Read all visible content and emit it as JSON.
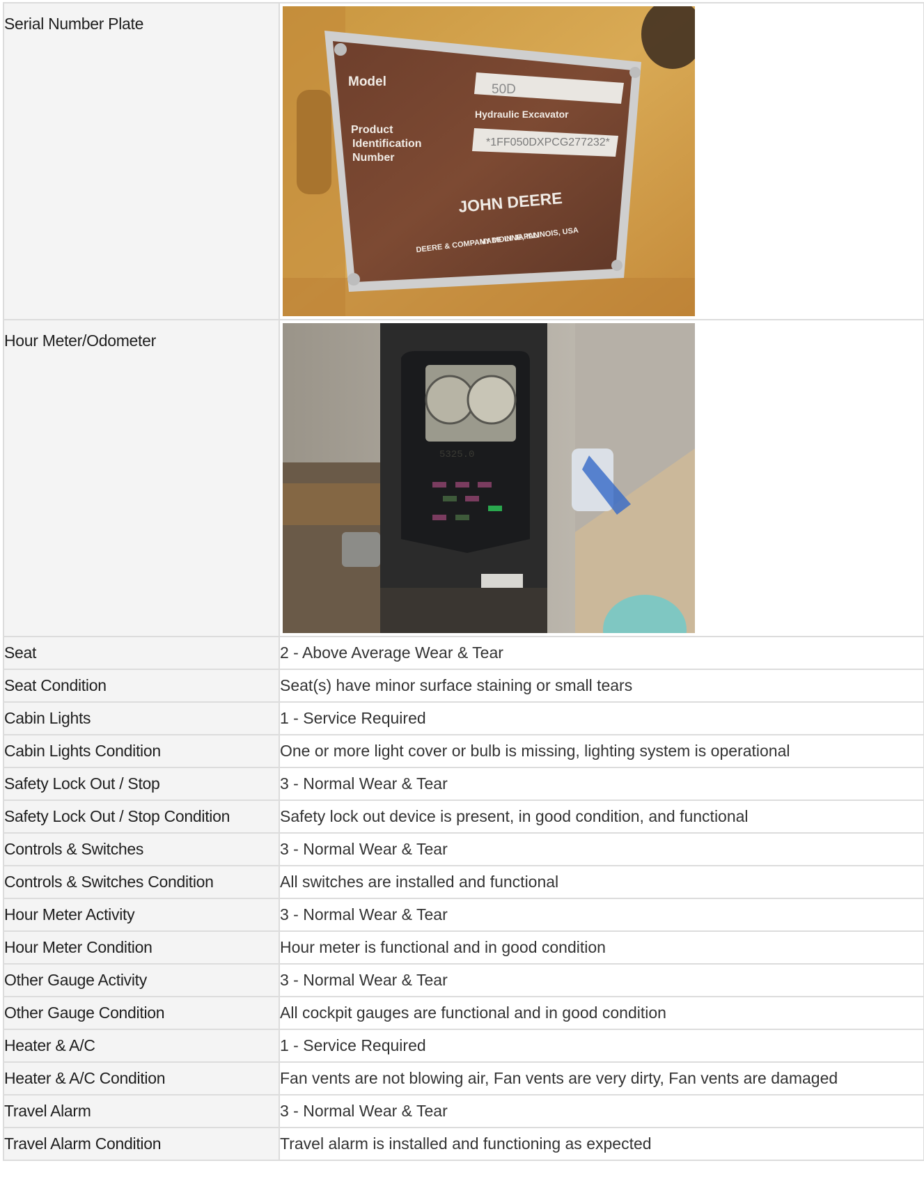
{
  "photos": {
    "serial_plate": {
      "label": "Serial Number Plate",
      "plate_model_label": "Model",
      "plate_model_value": "50D",
      "plate_type": "Hydraulic Excavator",
      "plate_pin_label_1": "Product",
      "plate_pin_label_2": "Identification",
      "plate_pin_label_3": "Number",
      "plate_pin_value": "*1FF050DXPCG277232*",
      "plate_brand": "JOHN DEERE",
      "plate_company": "DEERE & COMPANY MOLINE, ILLINOIS, USA",
      "plate_made_in": "MADE IN JAPAN"
    },
    "hour_meter": {
      "label": "Hour Meter/Odometer",
      "display_reading": "5325.0"
    }
  },
  "rows": [
    {
      "label": "Seat",
      "value": "2 - Above Average Wear & Tear"
    },
    {
      "label": "Seat Condition",
      "value": "Seat(s) have minor surface staining or small tears"
    },
    {
      "label": "Cabin Lights",
      "value": "1 - Service Required"
    },
    {
      "label": "Cabin Lights Condition",
      "value": "One or more light cover or bulb is missing, lighting system is operational"
    },
    {
      "label": "Safety Lock Out / Stop",
      "value": "3 - Normal Wear & Tear"
    },
    {
      "label": "Safety Lock Out / Stop Condition",
      "value": "Safety lock out device is present, in good condition, and functional"
    },
    {
      "label": "Controls & Switches",
      "value": "3 - Normal Wear & Tear"
    },
    {
      "label": "Controls & Switches Condition",
      "value": "All switches are installed and functional"
    },
    {
      "label": "Hour Meter Activity",
      "value": "3 - Normal Wear & Tear"
    },
    {
      "label": "Hour Meter Condition",
      "value": "Hour meter is functional and in good condition"
    },
    {
      "label": "Other Gauge Activity",
      "value": "3 - Normal Wear & Tear"
    },
    {
      "label": "Other Gauge Condition",
      "value": "All cockpit gauges are functional and in good condition"
    },
    {
      "label": "Heater & A/C",
      "value": "1 - Service Required"
    },
    {
      "label": "Heater & A/C Condition",
      "value": "Fan vents are not blowing air, Fan vents are very dirty, Fan vents are damaged"
    },
    {
      "label": "Travel Alarm",
      "value": "3 - Normal Wear & Tear"
    },
    {
      "label": "Travel Alarm Condition",
      "value": "Travel alarm is installed and functioning as expected"
    }
  ]
}
